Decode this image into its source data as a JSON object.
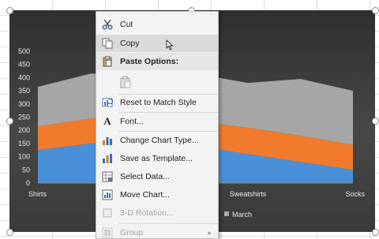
{
  "chart_data": {
    "type": "area",
    "stacked": true,
    "categories": [
      "Shirts",
      "",
      "",
      "",
      "Sweatshirts",
      "",
      "Socks"
    ],
    "visible_x_labels": [
      "Shirts",
      "Sweatshirts",
      "Socks"
    ],
    "y_ticks": [
      "0",
      "50",
      "100",
      "150",
      "200",
      "250",
      "300",
      "350",
      "400",
      "450",
      "500"
    ],
    "ylim": [
      0,
      500
    ],
    "series": [
      {
        "color": "#4a90d9",
        "values": [
          125,
          150,
          155,
          140,
          110,
          80,
          50
        ]
      },
      {
        "color": "#f07b2d",
        "values": [
          90,
          95,
          90,
          95,
          100,
          100,
          95
        ]
      },
      {
        "color": "#a6a6a6",
        "values": [
          150,
          170,
          170,
          180,
          170,
          215,
          205
        ]
      }
    ],
    "legend": {
      "visible_entries": [
        "March"
      ],
      "placement": "bottom"
    },
    "background": "#3a3a3a",
    "grid": false
  },
  "context_menu": {
    "items": [
      {
        "icon": "cut-icon",
        "label": "Cut",
        "state": "normal"
      },
      {
        "icon": "copy-icon",
        "label": "Copy",
        "state": "highlighted"
      },
      {
        "icon": "",
        "label": "Paste Options:",
        "state": "header"
      },
      {
        "icon": "paste-icon",
        "label": "",
        "state": "disabled"
      },
      {
        "icon": "reset-style-icon",
        "label": "Reset to Match Style",
        "state": "normal"
      },
      {
        "icon": "font-icon",
        "label": "Font...",
        "state": "normal"
      },
      {
        "icon": "chart-type-icon",
        "label": "Change Chart Type...",
        "state": "normal"
      },
      {
        "icon": "template-icon",
        "label": "Save as Template...",
        "state": "normal"
      },
      {
        "icon": "select-data-icon",
        "label": "Select Data...",
        "state": "normal"
      },
      {
        "icon": "move-chart-icon",
        "label": "Move Chart...",
        "state": "normal"
      },
      {
        "icon": "rotation-icon",
        "label": "3-D Rotation...",
        "state": "disabled"
      },
      {
        "icon": "group-icon",
        "label": "Group",
        "state": "disabled",
        "submenu": true
      }
    ]
  },
  "colors": {
    "accent_blue": "#4a90d9",
    "accent_orange": "#f07b2d",
    "accent_gray": "#a6a6a6"
  }
}
